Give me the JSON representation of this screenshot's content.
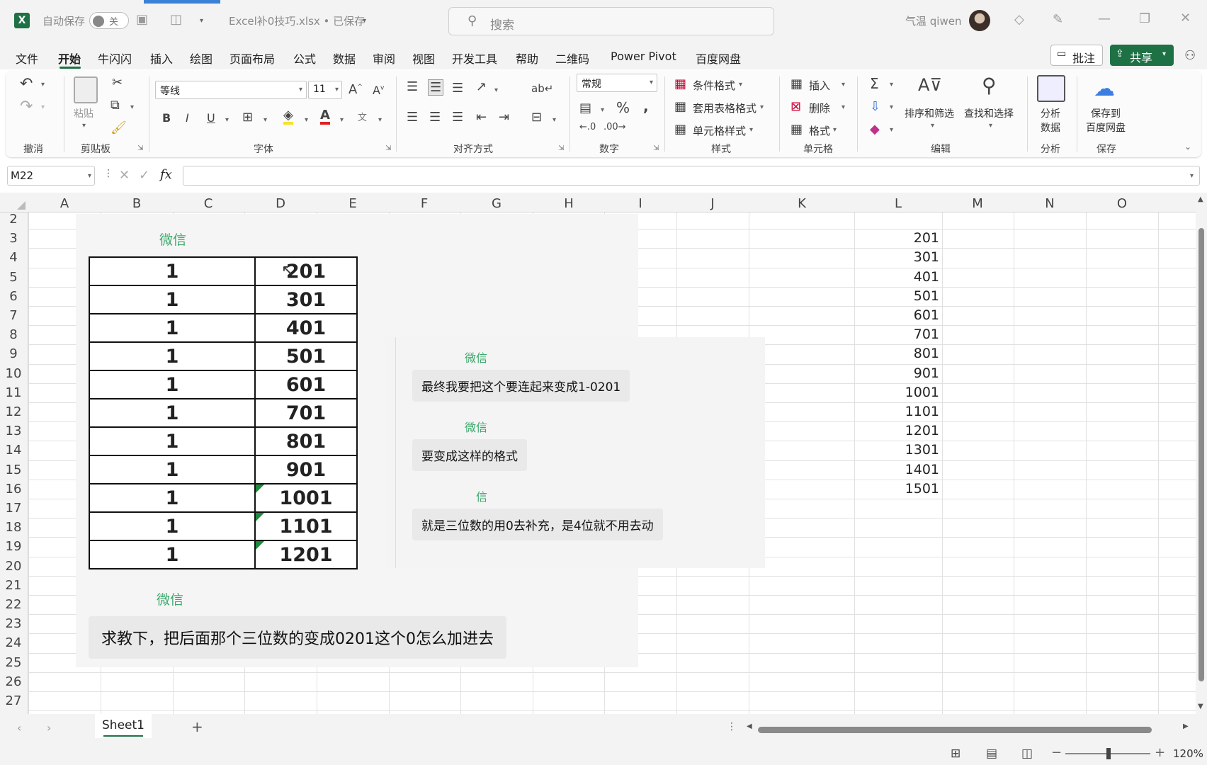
{
  "titlebar": {
    "autosave_label": "自动保存",
    "autosave_state": "关",
    "filename": "Excel补0技巧.xlsx • 已保存",
    "search_placeholder": "搜索",
    "user_name": "气温 qiwen"
  },
  "menu": [
    "文件",
    "开始",
    "牛闪闪",
    "插入",
    "绘图",
    "页面布局",
    "公式",
    "数据",
    "审阅",
    "视图",
    "开发工具",
    "帮助",
    "二维码",
    "Power Pivot",
    "百度网盘"
  ],
  "menu_right": {
    "comment_label": "批注",
    "share_label": "共享"
  },
  "ribbon": {
    "groups": [
      "撤消",
      "剪贴板",
      "字体",
      "对齐方式",
      "数字",
      "样式",
      "单元格",
      "编辑",
      "分析",
      "保存"
    ],
    "paste_label": "粘贴",
    "font_name": "等线",
    "font_size": "11",
    "number_format": "常规",
    "styles": [
      "条件格式",
      "套用表格格式",
      "单元格样式"
    ],
    "cells": [
      "插入",
      "删除",
      "格式"
    ],
    "sort_filter": "排序和筛选",
    "find_select": "查找和选择",
    "analyze": [
      "分析",
      "数据"
    ],
    "save_baidu": [
      "保存到",
      "百度网盘"
    ]
  },
  "formula_bar": {
    "name_box": "M22",
    "fx": "fx",
    "formula": ""
  },
  "columns": [
    "A",
    "B",
    "C",
    "D",
    "E",
    "F",
    "G",
    "H",
    "I",
    "J",
    "K",
    "L",
    "M",
    "N",
    "O"
  ],
  "rows": [
    "2",
    "3",
    "4",
    "5",
    "6",
    "7",
    "8",
    "9",
    "10",
    "11",
    "12",
    "13",
    "14",
    "15",
    "16",
    "17",
    "18",
    "19",
    "20",
    "21",
    "22",
    "23",
    "24",
    "25",
    "26",
    "27"
  ],
  "column_L_values": [
    "201",
    "301",
    "401",
    "501",
    "601",
    "701",
    "801",
    "901",
    "1001",
    "1101",
    "1201",
    "1301",
    "1401",
    "1501"
  ],
  "chat_image": {
    "sender_top": "微信",
    "table_left": [
      "1",
      "1",
      "1",
      "1",
      "1",
      "1",
      "1",
      "1",
      "1",
      "1",
      "1"
    ],
    "table_right": [
      "201",
      "301",
      "401",
      "501",
      "601",
      "701",
      "801",
      "901",
      "1001",
      "1101",
      "1201"
    ],
    "sender_bottom": "微信",
    "message_bottom": "求教下，把后面那个三位数的变成0201这个0怎么加进去"
  },
  "chat_image2": {
    "messages": [
      {
        "sender": "微信",
        "text": "最终我要把这个要连起来变成1-0201"
      },
      {
        "sender": "微信",
        "text": "要变成这样的格式"
      },
      {
        "sender": "信",
        "text": "就是三位数的用0去补充，是4位就不用去动"
      }
    ]
  },
  "sheet_tabs": [
    "Sheet1"
  ],
  "status": {
    "zoom": "120%"
  }
}
